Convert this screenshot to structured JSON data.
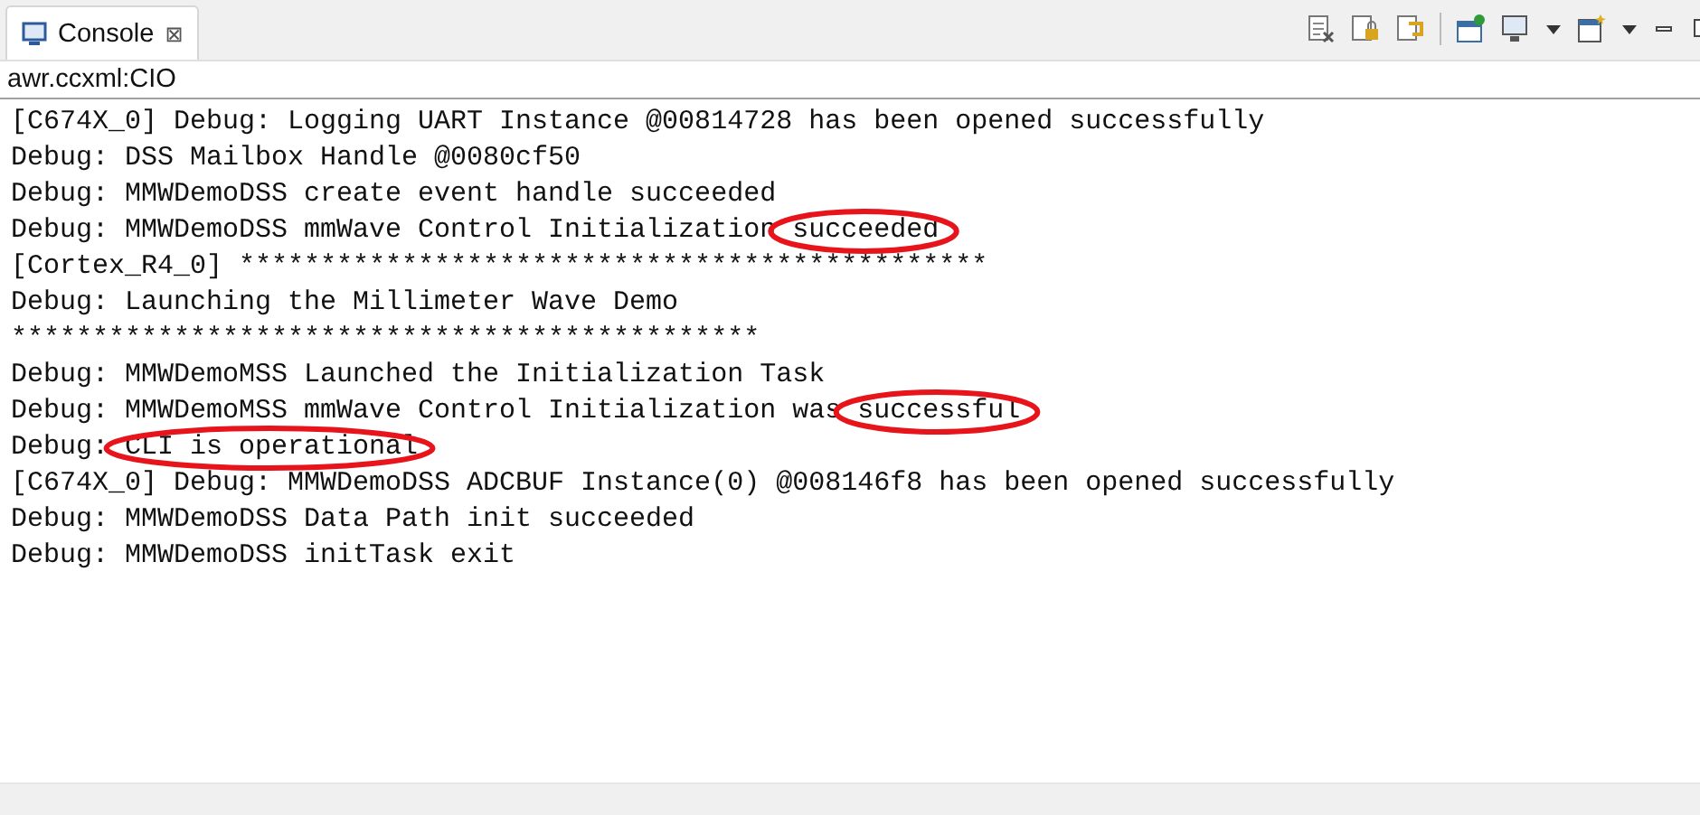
{
  "tab": {
    "label": "Console",
    "close": "⊠",
    "selected": true
  },
  "subtitle": "awr.ccxml:CIO",
  "lines": [
    {
      "parts": [
        {
          "text": "[C674X_0] Debug: Logging UART Instance @00814728 has been opened successfully",
          "circled": false
        }
      ]
    },
    {
      "parts": [
        {
          "text": "Debug: DSS Mailbox Handle @0080cf50",
          "circled": false
        }
      ]
    },
    {
      "parts": [
        {
          "text": "Debug: MMWDemoDSS create event handle succeeded",
          "circled": false
        }
      ]
    },
    {
      "parts": [
        {
          "text": "Debug: MMWDemoDSS mmWave Control Initialization ",
          "circled": false
        },
        {
          "text": "succeeded",
          "circled": true
        }
      ]
    },
    {
      "parts": [
        {
          "text": "[Cortex_R4_0] **********************************************",
          "circled": false
        }
      ]
    },
    {
      "parts": [
        {
          "text": "Debug: Launching the Millimeter Wave Demo",
          "circled": false
        }
      ]
    },
    {
      "parts": [
        {
          "text": "**********************************************",
          "circled": false
        }
      ]
    },
    {
      "parts": [
        {
          "text": "Debug: MMWDemoMSS Launched the Initialization Task",
          "circled": false
        }
      ]
    },
    {
      "parts": [
        {
          "text": "Debug: MMWDemoMSS mmWave Control Initialization was ",
          "circled": false
        },
        {
          "text": "successful",
          "circled": true
        }
      ]
    },
    {
      "parts": [
        {
          "text": "Debug: ",
          "circled": false
        },
        {
          "text": "CLI is operational",
          "circled": true
        }
      ]
    },
    {
      "parts": [
        {
          "text": "[C674X_0] Debug: MMWDemoDSS ADCBUF Instance(0) @008146f8 has been opened successfully",
          "circled": false
        }
      ]
    },
    {
      "parts": [
        {
          "text": "Debug: MMWDemoDSS Data Path init succeeded",
          "circled": false
        }
      ]
    },
    {
      "parts": [
        {
          "text": "Debug: MMWDemoDSS initTask exit",
          "circled": false
        }
      ]
    }
  ]
}
